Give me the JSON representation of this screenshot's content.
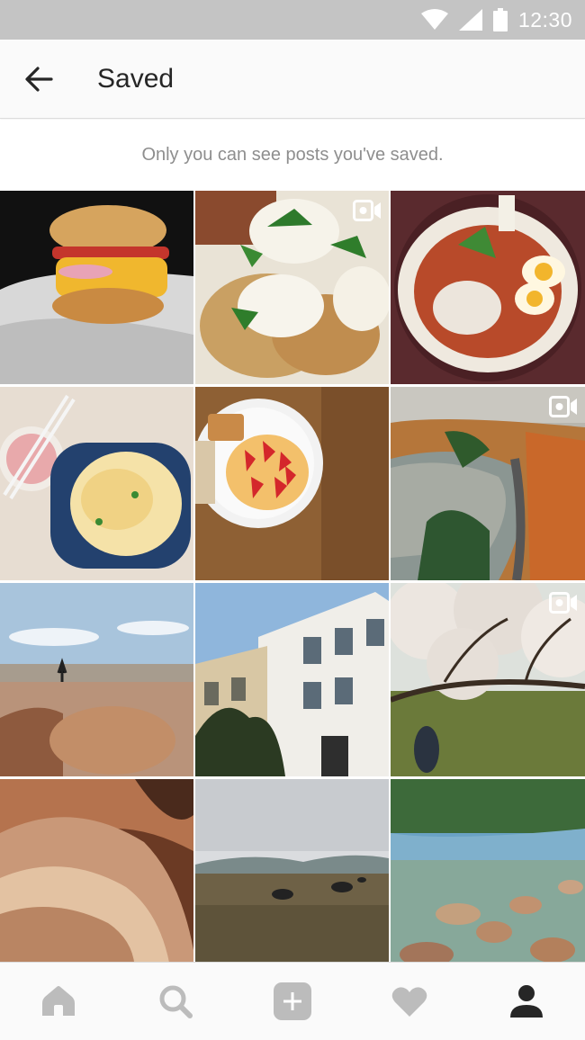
{
  "status_bar": {
    "time": "12:30",
    "icons": [
      "wifi-icon",
      "cellular-signal-icon",
      "battery-icon"
    ]
  },
  "header": {
    "title": "Saved",
    "back_icon": "arrow-left-icon"
  },
  "notice": "Only you can see posts you've saved.",
  "posts": [
    {
      "subject": "burger",
      "video": false
    },
    {
      "subject": "eggs benedict",
      "video": true
    },
    {
      "subject": "ramen bowl",
      "video": false
    },
    {
      "subject": "soup with chopsticks",
      "video": false
    },
    {
      "subject": "toast and strawberries",
      "video": false
    },
    {
      "subject": "autumn river road",
      "video": true
    },
    {
      "subject": "canyon jumper",
      "video": false
    },
    {
      "subject": "victorian houses",
      "video": false
    },
    {
      "subject": "blossom tree by pond",
      "video": true
    },
    {
      "subject": "slot canyon",
      "video": false
    },
    {
      "subject": "grazing field",
      "video": false
    },
    {
      "subject": "clear lake rocks",
      "video": false
    }
  ],
  "tabs": [
    {
      "icon": "home-icon",
      "active": false
    },
    {
      "icon": "search-icon",
      "active": false
    },
    {
      "icon": "add-post-icon",
      "active": false
    },
    {
      "icon": "heart-icon",
      "active": false
    },
    {
      "icon": "profile-icon",
      "active": true
    }
  ],
  "colors": {
    "status_bar": "#c4c4c4",
    "text_primary": "#262626",
    "text_secondary": "#8e8e8e",
    "tab_inactive": "#bcbcbc",
    "tab_active": "#262626"
  }
}
